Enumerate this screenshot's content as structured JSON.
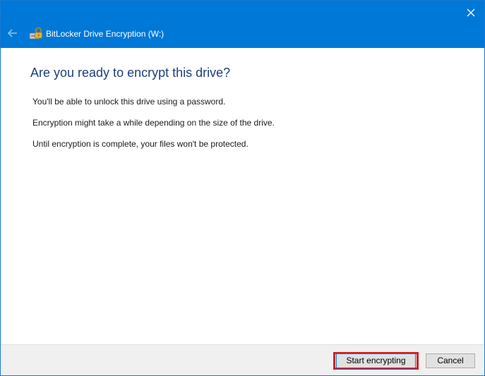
{
  "window": {
    "title": "BitLocker Drive Encryption (W:)",
    "accent_color": "#0078d7",
    "title_text_color": "#ffffff",
    "icons": {
      "close": "close-icon",
      "back": "back-arrow-icon",
      "app": "bitlocker-drive-icon"
    }
  },
  "main": {
    "heading": "Are you ready to encrypt this drive?",
    "heading_color": "#1e3f7a",
    "lines": [
      "You'll be able to unlock this drive using a password.",
      "Encryption might take a while depending on the size of the drive.",
      "Until encryption is complete, your files won't be protected."
    ]
  },
  "footer": {
    "start_button_label": "Start encrypting",
    "cancel_button_label": "Cancel",
    "highlight_color": "#d0202a"
  }
}
